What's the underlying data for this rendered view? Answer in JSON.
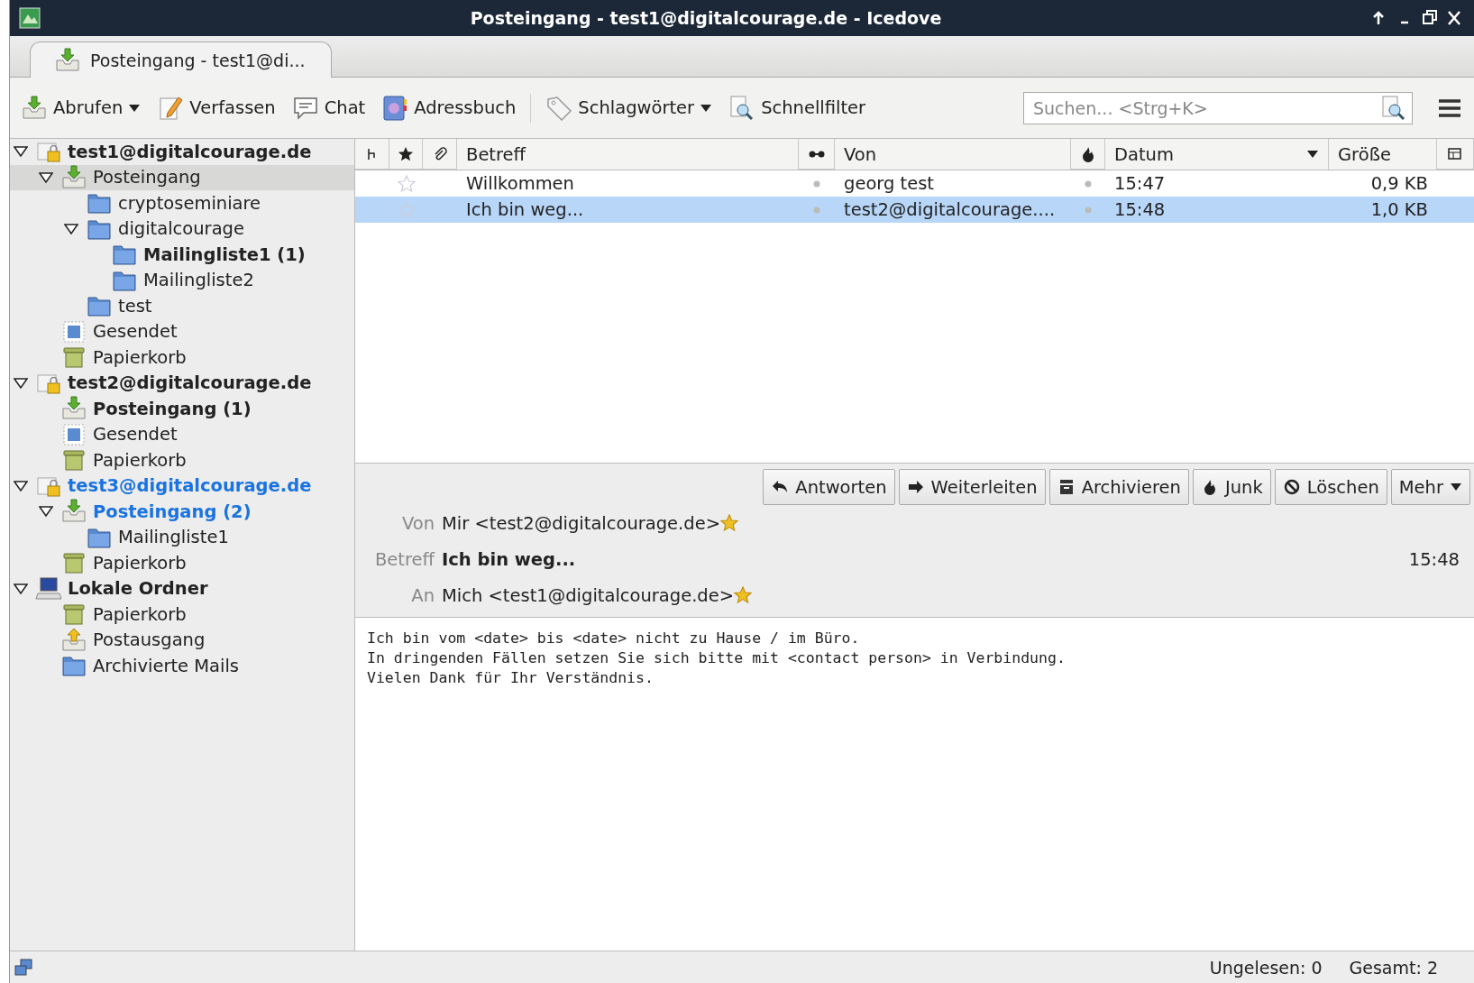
{
  "window": {
    "title": "Posteingang - test1@digitalcourage.de - Icedove"
  },
  "tabs": [
    {
      "label": "Posteingang - test1@di...",
      "selected": true
    }
  ],
  "toolbar": {
    "buttons": [
      {
        "kind": "get",
        "label": "Abrufen",
        "has_menu": true
      },
      {
        "kind": "write",
        "label": "Verfassen",
        "has_menu": false
      },
      {
        "kind": "chat",
        "label": "Chat",
        "has_menu": false
      },
      {
        "kind": "address",
        "label": "Adressbuch",
        "has_menu": false
      },
      {
        "kind": "tags",
        "label": "Schlagwörter",
        "has_menu": true
      },
      {
        "kind": "filter",
        "label": "Schnellfilter",
        "has_menu": false
      }
    ],
    "search": {
      "placeholder": "Suchen... <Strg+K>"
    }
  },
  "folders": [
    {
      "kind": "account",
      "label": "test1@digitalcourage.de",
      "unread": true,
      "new_mail": false,
      "selected": false,
      "expanded": true,
      "children": [
        {
          "kind": "inbox",
          "label": "Posteingang",
          "unread": false,
          "new_mail": false,
          "selected": true,
          "expanded": true,
          "children": [
            {
              "kind": "folder",
              "label": "cryptoseminiare",
              "unread": false,
              "new_mail": false,
              "selected": false
            },
            {
              "kind": "folder",
              "label": "digitalcourage",
              "unread": false,
              "new_mail": false,
              "selected": false,
              "expanded": true,
              "children": [
                {
                  "kind": "folder",
                  "label": "Mailingliste1 (1)",
                  "unread": true,
                  "new_mail": false,
                  "selected": false
                },
                {
                  "kind": "folder",
                  "label": "Mailingliste2",
                  "unread": false,
                  "new_mail": false,
                  "selected": false
                }
              ]
            },
            {
              "kind": "folder",
              "label": "test",
              "unread": false,
              "new_mail": false,
              "selected": false
            }
          ]
        },
        {
          "kind": "sent",
          "label": "Gesendet",
          "unread": false,
          "new_mail": false,
          "selected": false
        },
        {
          "kind": "trash",
          "label": "Papierkorb",
          "unread": false,
          "new_mail": false,
          "selected": false
        }
      ]
    },
    {
      "kind": "account",
      "label": "test2@digitalcourage.de",
      "unread": true,
      "new_mail": false,
      "selected": false,
      "expanded": true,
      "children": [
        {
          "kind": "inbox",
          "label": "Posteingang (1)",
          "unread": true,
          "new_mail": false,
          "selected": false
        },
        {
          "kind": "sent",
          "label": "Gesendet",
          "unread": false,
          "new_mail": false,
          "selected": false
        },
        {
          "kind": "trash",
          "label": "Papierkorb",
          "unread": false,
          "new_mail": false,
          "selected": false
        }
      ]
    },
    {
      "kind": "account",
      "label": "test3@digitalcourage.de",
      "unread": true,
      "new_mail": true,
      "selected": false,
      "expanded": true,
      "children": [
        {
          "kind": "inbox",
          "label": "Posteingang (2)",
          "unread": true,
          "new_mail": true,
          "selected": false,
          "expanded": true,
          "children": [
            {
              "kind": "folder",
              "label": "Mailingliste1",
              "unread": false,
              "new_mail": false,
              "selected": false
            }
          ]
        },
        {
          "kind": "trash",
          "label": "Papierkorb",
          "unread": false,
          "new_mail": false,
          "selected": false
        }
      ]
    },
    {
      "kind": "local",
      "label": "Lokale Ordner",
      "unread": true,
      "new_mail": false,
      "selected": false,
      "expanded": true,
      "children": [
        {
          "kind": "trash",
          "label": "Papierkorb",
          "unread": false,
          "new_mail": false,
          "selected": false
        },
        {
          "kind": "outbox",
          "label": "Postausgang",
          "unread": false,
          "new_mail": false,
          "selected": false
        },
        {
          "kind": "folder",
          "label": "Archivierte Mails",
          "unread": false,
          "new_mail": false,
          "selected": false
        }
      ]
    }
  ],
  "message_list": {
    "columns": [
      {
        "kind": "thread"
      },
      {
        "kind": "star"
      },
      {
        "kind": "attachment"
      },
      {
        "kind": "text",
        "label": "Betreff",
        "sorted": false
      },
      {
        "kind": "read"
      },
      {
        "kind": "text",
        "label": "Von",
        "sorted": false
      },
      {
        "kind": "junk"
      },
      {
        "kind": "text",
        "label": "Datum",
        "sorted": true
      },
      {
        "kind": "text",
        "label": "Größe",
        "sorted": false
      },
      {
        "kind": "picker"
      }
    ],
    "rows": [
      {
        "subject": "Willkommen",
        "from": "georg test",
        "date": "15:47",
        "size": "0,9 KB",
        "starred": false,
        "selected": false
      },
      {
        "subject": "Ich bin weg...",
        "from": "test2@digitalcourage....",
        "date": "15:48",
        "size": "1,0 KB",
        "starred": false,
        "selected": true
      }
    ]
  },
  "message": {
    "actions": [
      {
        "kind": "reply",
        "label": "Antworten",
        "has_menu": false
      },
      {
        "kind": "forward",
        "label": "Weiterleiten",
        "has_menu": false
      },
      {
        "kind": "archive",
        "label": "Archivieren",
        "has_menu": false
      },
      {
        "kind": "junk",
        "label": "Junk",
        "has_menu": false
      },
      {
        "kind": "delete",
        "label": "Löschen",
        "has_menu": false
      },
      {
        "kind": "more",
        "label": "Mehr",
        "has_menu": true
      }
    ],
    "from_label": "Von",
    "from": "Mir <test2@digitalcourage.de>",
    "subject_label": "Betreff",
    "subject": "Ich bin weg...",
    "time": "15:48",
    "to_label": "An",
    "to": "Mich <test1@digitalcourage.de>",
    "body": "Ich bin vom <date> bis <date> nicht zu Hause / im Büro.\nIn dringenden Fällen setzen Sie sich bitte mit <contact person> in Verbindung.\nVielen Dank für Ihr Verständnis."
  },
  "status_bar": {
    "unread": "Ungelesen: 0",
    "total": "Gesamt: 2"
  }
}
